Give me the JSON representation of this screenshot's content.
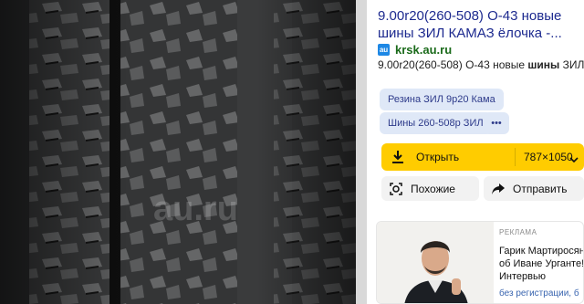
{
  "result": {
    "title": "9.00r20(260-508) О-43 новые шины ЗИЛ КАМАЗ ёлочка -...",
    "source_badge": "au",
    "source": "krsk.au.ru",
    "snippet_pre": "9.00r20(260-508) О-43 новые ",
    "snippet_bold": "шины",
    "snippet_post": " ЗИЛ К",
    "snippet_more": "А"
  },
  "chips": {
    "chip1": "Резина ЗИЛ 9р20 Кама",
    "chip2": "Шины 260-508р ЗИЛ",
    "more": "•••"
  },
  "actions": {
    "open_label": "Открыть",
    "size": "787×1050",
    "similar_label": "Похожие",
    "share_label": "Отправить"
  },
  "ad": {
    "label": "РЕКЛАМА",
    "title": "Гарик Мартиросян об Иване Урганте! Интервью",
    "subtitle": "без регистрации, б"
  },
  "watermark": "au.ru"
}
